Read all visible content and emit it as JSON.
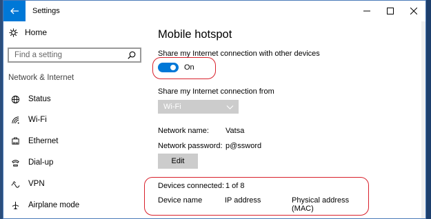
{
  "window": {
    "title": "Settings"
  },
  "sidebar": {
    "home_label": "Home",
    "search_placeholder": "Find a setting",
    "section_heading": "Network & Internet",
    "items": [
      {
        "label": "Status",
        "icon": "globe-icon"
      },
      {
        "label": "Wi-Fi",
        "icon": "wifi-icon"
      },
      {
        "label": "Ethernet",
        "icon": "ethernet-icon"
      },
      {
        "label": "Dial-up",
        "icon": "phone-icon"
      },
      {
        "label": "VPN",
        "icon": "vpn-icon"
      },
      {
        "label": "Airplane mode",
        "icon": "airplane-icon"
      }
    ]
  },
  "main": {
    "title": "Mobile hotspot",
    "share_label": "Share my Internet connection with other devices",
    "toggle_state": "On",
    "share_from_label": "Share my Internet connection from",
    "share_from_value": "Wi-Fi",
    "network_name_key": "Network name:",
    "network_name_value": "Vatsa",
    "network_password_key": "Network password:",
    "network_password_value": "p@ssword",
    "edit_label": "Edit",
    "devices_connected_key": "Devices connected:",
    "devices_connected_value": "1 of 8",
    "columns": [
      "Device name",
      "IP address",
      "Physical address\n(MAC)"
    ]
  },
  "colors": {
    "accent": "#0078d7",
    "annotation": "#d81f2a"
  }
}
